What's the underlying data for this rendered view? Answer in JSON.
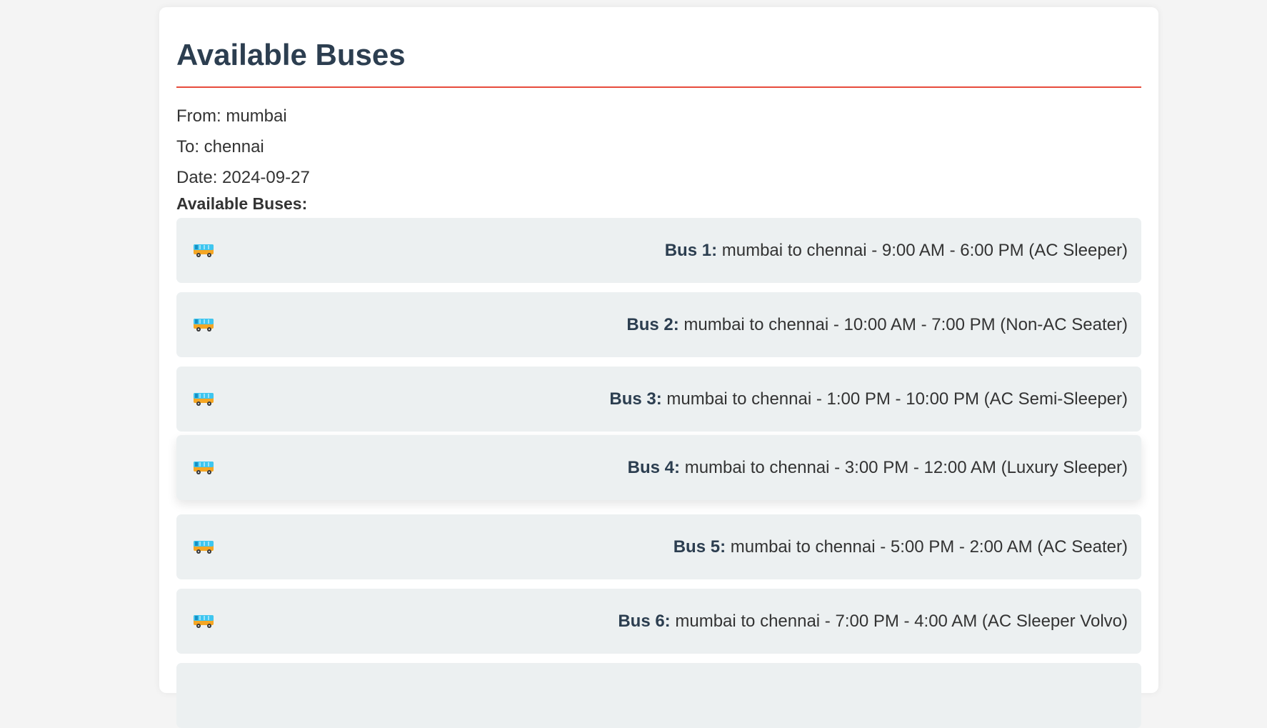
{
  "header": {
    "title": "Available Buses"
  },
  "search": {
    "from": "From: mumbai",
    "to": "To: chennai",
    "date": "Date: 2024-09-27"
  },
  "list_label": "Available Buses:",
  "buses": [
    {
      "name": "Bus 1:",
      "details": " mumbai to chennai - 9:00 AM - 6:00 PM (AC Sleeper)",
      "icon": "bus-icon"
    },
    {
      "name": "Bus 2:",
      "details": " mumbai to chennai - 10:00 AM - 7:00 PM (Non-AC Seater)",
      "icon": "bus-icon"
    },
    {
      "name": "Bus 3:",
      "details": " mumbai to chennai - 1:00 PM - 10:00 PM (AC Semi-Sleeper)",
      "icon": "bus-icon"
    },
    {
      "name": "Bus 4:",
      "details": " mumbai to chennai - 3:00 PM - 12:00 AM (Luxury Sleeper)",
      "icon": "bus-icon"
    },
    {
      "name": "Bus 5:",
      "details": " mumbai to chennai - 5:00 PM - 2:00 AM (AC Seater)",
      "icon": "bus-icon"
    },
    {
      "name": "Bus 6:",
      "details": " mumbai to chennai - 7:00 PM - 4:00 AM (AC Sleeper Volvo)",
      "icon": "bus-icon"
    }
  ],
  "colors": {
    "accent": "#e74c3c",
    "title": "#2c3e50",
    "row_bg": "#ecf0f1",
    "page_bg": "#f4f4f4"
  }
}
